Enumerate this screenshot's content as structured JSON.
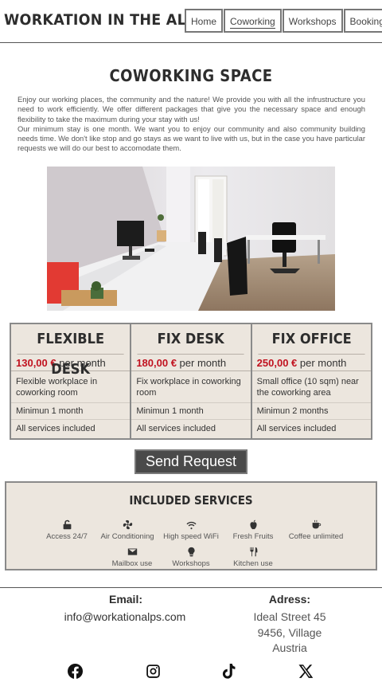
{
  "header": {
    "logo": "WORKATION IN THE ALPS",
    "nav": [
      {
        "label": "Home"
      },
      {
        "label": "Coworking"
      },
      {
        "label": "Workshops"
      },
      {
        "label": "Booking"
      }
    ]
  },
  "main": {
    "title": "COWORKING SPACE",
    "intro": [
      "Enjoy our working places, the community and the nature! We provide you with all the infrustructure you need to work efficiently. We offer different packages that give you the necessary space and enough flexibility to take the maximum during your stay with us!",
      "Our minimum stay is one month. We want you to enjoy our community and also community building needs time. We don't like stop and go stays as we want to live with us, but in the case you have particular requests we will do our best to accomodate them."
    ]
  },
  "plans": [
    {
      "title": "FLEXIBLE DESK",
      "price": "130,00 €",
      "period": " per month",
      "line1": "Flexible workplace in coworking room",
      "line2": "Minimun 1 month",
      "line3": "All services included"
    },
    {
      "title": "FIX DESK",
      "price": "180,00 €",
      "period": " per month",
      "line1": "Fix workplace in coworking room",
      "line2": "Minimun 1 month",
      "line3": "All services included"
    },
    {
      "title": "FIX OFFICE",
      "price": "250,00 €",
      "period": " per month",
      "line1": "Small office (10 sqm) near the coworking area",
      "line2": "Minimun 2 months",
      "line3": "All services included"
    }
  ],
  "send_button": "Send Request",
  "services": {
    "title": "INCLUDED SERVICES",
    "items": [
      {
        "label": "Access 24/7",
        "icon": "lock-open-icon"
      },
      {
        "label": "Air Conditioning",
        "icon": "fan-icon"
      },
      {
        "label": "High speed WiFi",
        "icon": "wifi-icon"
      },
      {
        "label": "Fresh Fruits",
        "icon": "apple-icon"
      },
      {
        "label": "Coffee unlimited",
        "icon": "coffee-icon"
      },
      {
        "label": "Mailbox use",
        "icon": "envelope-icon"
      },
      {
        "label": "Workshops",
        "icon": "lightbulb-icon"
      },
      {
        "label": "Kitchen use",
        "icon": "utensils-icon"
      }
    ]
  },
  "footer": {
    "email_label": "Email:",
    "email": "info@workationalps.com",
    "address_label": "Adress:",
    "address": [
      "Ideal Street 45",
      "9456, Village",
      "Austria"
    ],
    "social": [
      "facebook-icon",
      "instagram-icon",
      "tiktok-icon",
      "x-icon"
    ]
  },
  "colors": {
    "accent_price": "#c1121f",
    "card_bg": "#ece6de",
    "button_bg": "#4a4a4a"
  }
}
